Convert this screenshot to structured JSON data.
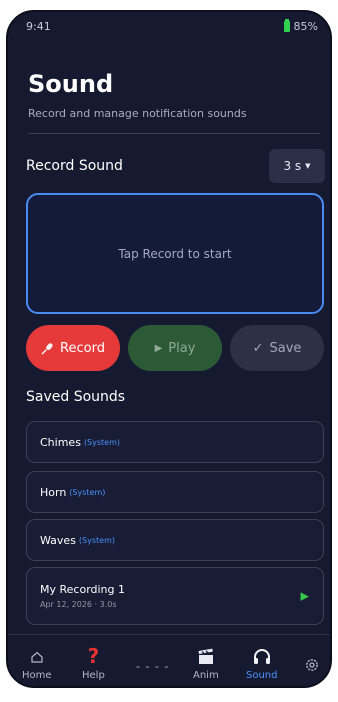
{
  "status": {
    "time": "9:41",
    "battery": "85%"
  },
  "header": {
    "title": "Sound",
    "subtitle": "Record and manage notification sounds"
  },
  "record": {
    "section_title": "Record Sound",
    "duration": "3 s",
    "panel_text": "Tap Record to start",
    "buttons": {
      "record": "Record",
      "play": "Play",
      "save": "Save"
    }
  },
  "saved": {
    "section_title": "Saved Sounds",
    "items": [
      {
        "name": "Chimes",
        "tag": "(System)"
      },
      {
        "name": "Horn",
        "tag": "(System)"
      },
      {
        "name": "Waves",
        "tag": "(System)"
      }
    ],
    "recording": {
      "name": "My Recording 1",
      "date": "Apr 12, 2026 · 3.0s"
    }
  },
  "tabs": [
    {
      "label": "Home",
      "icon": "home-icon"
    },
    {
      "label": "Help",
      "icon": "question-icon"
    },
    {
      "label": "",
      "icon": "more-dots-icon"
    },
    {
      "label": "Anim",
      "icon": "clapper-icon"
    },
    {
      "label": "Sound",
      "icon": "headphones-icon"
    },
    {
      "label": "",
      "icon": "settings-gear-icon"
    }
  ],
  "colors": {
    "accent": "#4a92ff",
    "record": "#e63a3a",
    "play_icon": "#37c84b",
    "background": "#161a30"
  }
}
